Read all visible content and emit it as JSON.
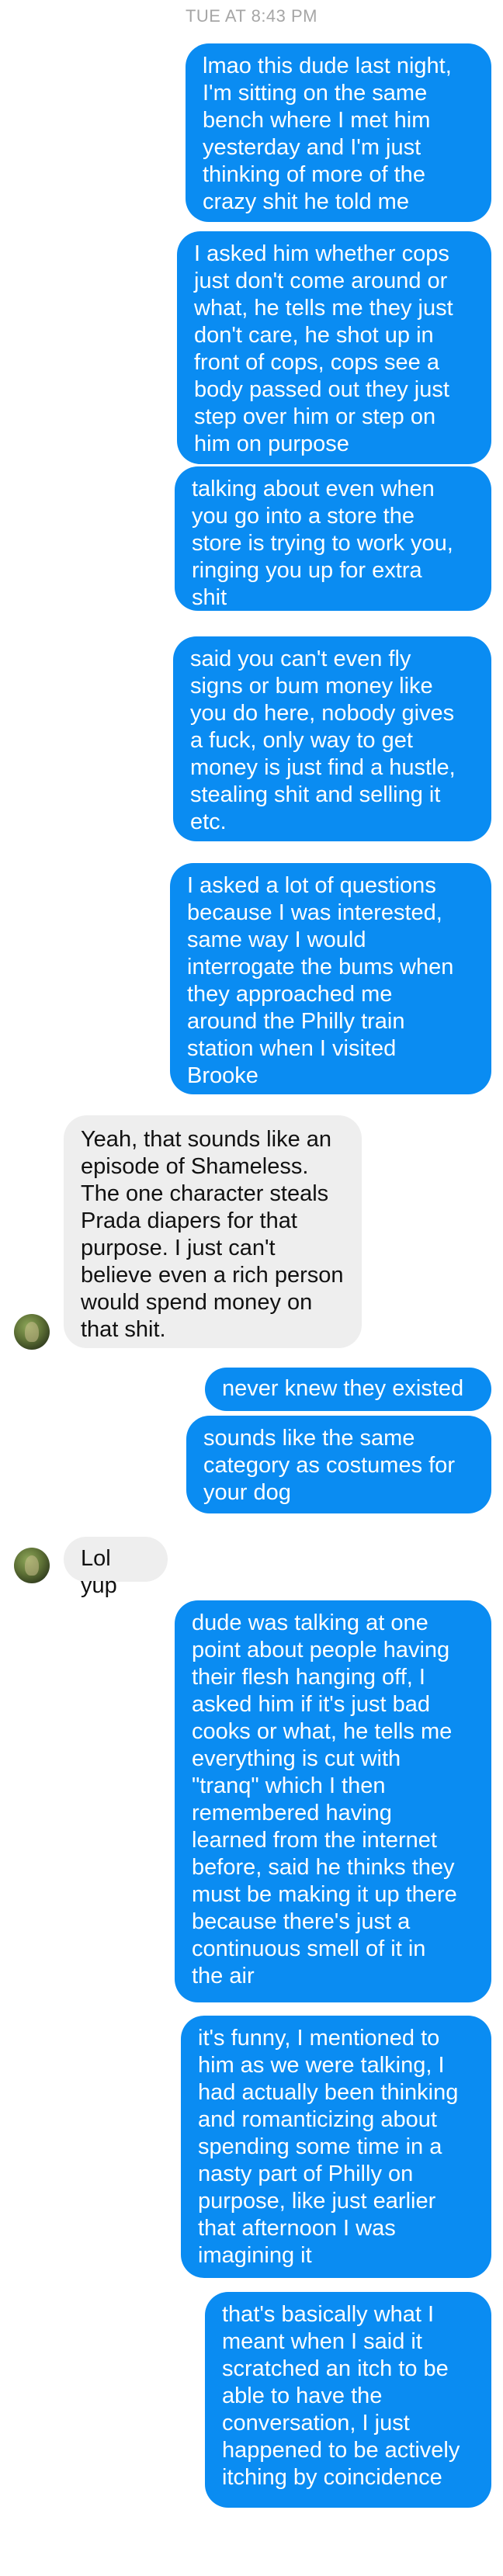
{
  "timestamp": "TUE AT 8:43 PM",
  "messages": [
    {
      "text": "lmao this dude last night,\nI'm sitting on the same\nbench where I met him\nyesterday and I'm just\nthinking of more of the\ncrazy shit he told me"
    },
    {
      "text": "I asked him whether cops\njust don't come around or\nwhat, he tells me they just\ndon't care, he shot up in\nfront of cops, cops see a\nbody passed out they just\nstep over him or step on\nhim on purpose"
    },
    {
      "text": "talking about even when\nyou go into a store the\nstore is trying to work you,\nringing you up for extra\nshit"
    },
    {
      "text": "said you can't even fly\nsigns or bum money like\nyou do here, nobody gives\na fuck, only way to get\nmoney is just find a hustle,\nstealing shit and selling it\netc."
    },
    {
      "text": "I asked a lot of questions\nbecause I was interested,\nsame way I would\ninterrogate the bums when\nthey approached me\naround the Philly train\nstation when I visited\nBrooke"
    },
    {
      "text": "Yeah, that sounds like an\nepisode of Shameless.\nThe one character steals\nPrada diapers for that\npurpose. I just can't\nbelieve even a rich person\nwould spend money on\nthat shit."
    },
    {
      "text": "never knew they existed"
    },
    {
      "text": "sounds like the same\ncategory as costumes for\nyour dog"
    },
    {
      "text": "Lol yup"
    },
    {
      "text": "dude was talking at one\npoint about people having\ntheir flesh hanging off, I\nasked him if it's just bad\ncooks or what, he tells me\neverything is cut with\n\"tranq\" which I then\nremembered having\nlearned from the internet\nbefore, said he thinks they\nmust be making it up there\nbecause there's just a\ncontinuous smell of it in\nthe air"
    },
    {
      "text": "it's funny, I mentioned to\nhim as we were talking, I\nhad actually been thinking\nand romanticizing about\nspending some time in a\nnasty part of Philly on\npurpose, like just earlier\nthat afternoon I was\nimagining it"
    },
    {
      "text": "that's basically what I\nmeant when I said it\nscratched an itch to be\nable to have the\nconversation, I just\nhappened to be actively\nitching by coincidence"
    }
  ],
  "colors": {
    "outgoing_bubble": "#0a8cf2",
    "incoming_bubble": "#eeeeee",
    "timestamp": "#a6a6a6"
  },
  "icons": {
    "avatar": "contact-avatar"
  }
}
